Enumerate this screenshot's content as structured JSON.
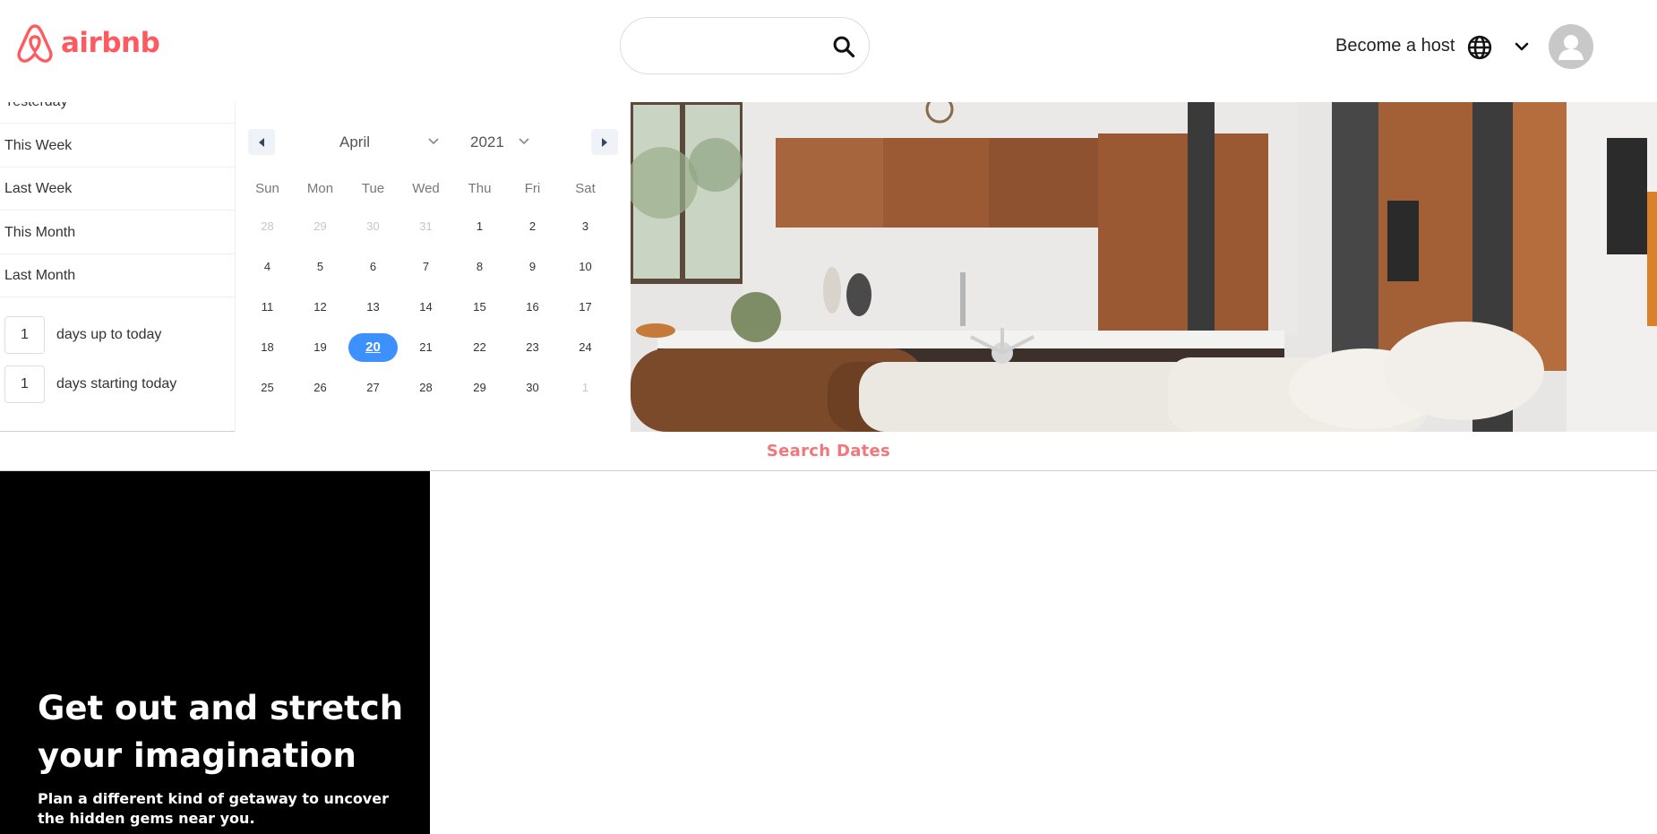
{
  "header": {
    "logo_text": "airbnb",
    "brand_color": "#FF5A5F",
    "host_link": "Become a host",
    "icons": [
      "airbnb-logo-icon",
      "search-icon",
      "globe-icon",
      "chevron-down-icon",
      "avatar-icon"
    ]
  },
  "ranges": {
    "items": [
      "Yesterday",
      "This Week",
      "Last Week",
      "This Month",
      "Last Month"
    ],
    "up_to_today": {
      "value": "1",
      "label": "days up to today"
    },
    "starting_today": {
      "value": "1",
      "label": "days starting today"
    }
  },
  "calendar": {
    "month": "April",
    "year": "2021",
    "weekdays": [
      "Sun",
      "Mon",
      "Tue",
      "Wed",
      "Thu",
      "Fri",
      "Sat"
    ],
    "weeks": [
      [
        "28",
        "29",
        "30",
        "31",
        "1",
        "2",
        "3"
      ],
      [
        "4",
        "5",
        "6",
        "7",
        "8",
        "9",
        "10"
      ],
      [
        "11",
        "12",
        "13",
        "14",
        "15",
        "16",
        "17"
      ],
      [
        "18",
        "19",
        "20",
        "21",
        "22",
        "23",
        "24"
      ],
      [
        "25",
        "26",
        "27",
        "28",
        "29",
        "30",
        "1"
      ]
    ],
    "muted": [
      [
        true,
        true,
        true,
        true,
        false,
        false,
        false
      ],
      [
        false,
        false,
        false,
        false,
        false,
        false,
        false
      ],
      [
        false,
        false,
        false,
        false,
        false,
        false,
        false
      ],
      [
        false,
        false,
        false,
        false,
        false,
        false,
        false
      ],
      [
        false,
        false,
        false,
        false,
        false,
        false,
        true
      ]
    ],
    "selected_day": "20",
    "selected_color": "#3d91ff"
  },
  "search_dates": {
    "label": "Search Dates",
    "color": "#F2777B"
  },
  "promo": {
    "title": "Get out and stretch your imagination",
    "subtitle": "Plan a different kind of getaway to uncover the hidden gems near you."
  }
}
